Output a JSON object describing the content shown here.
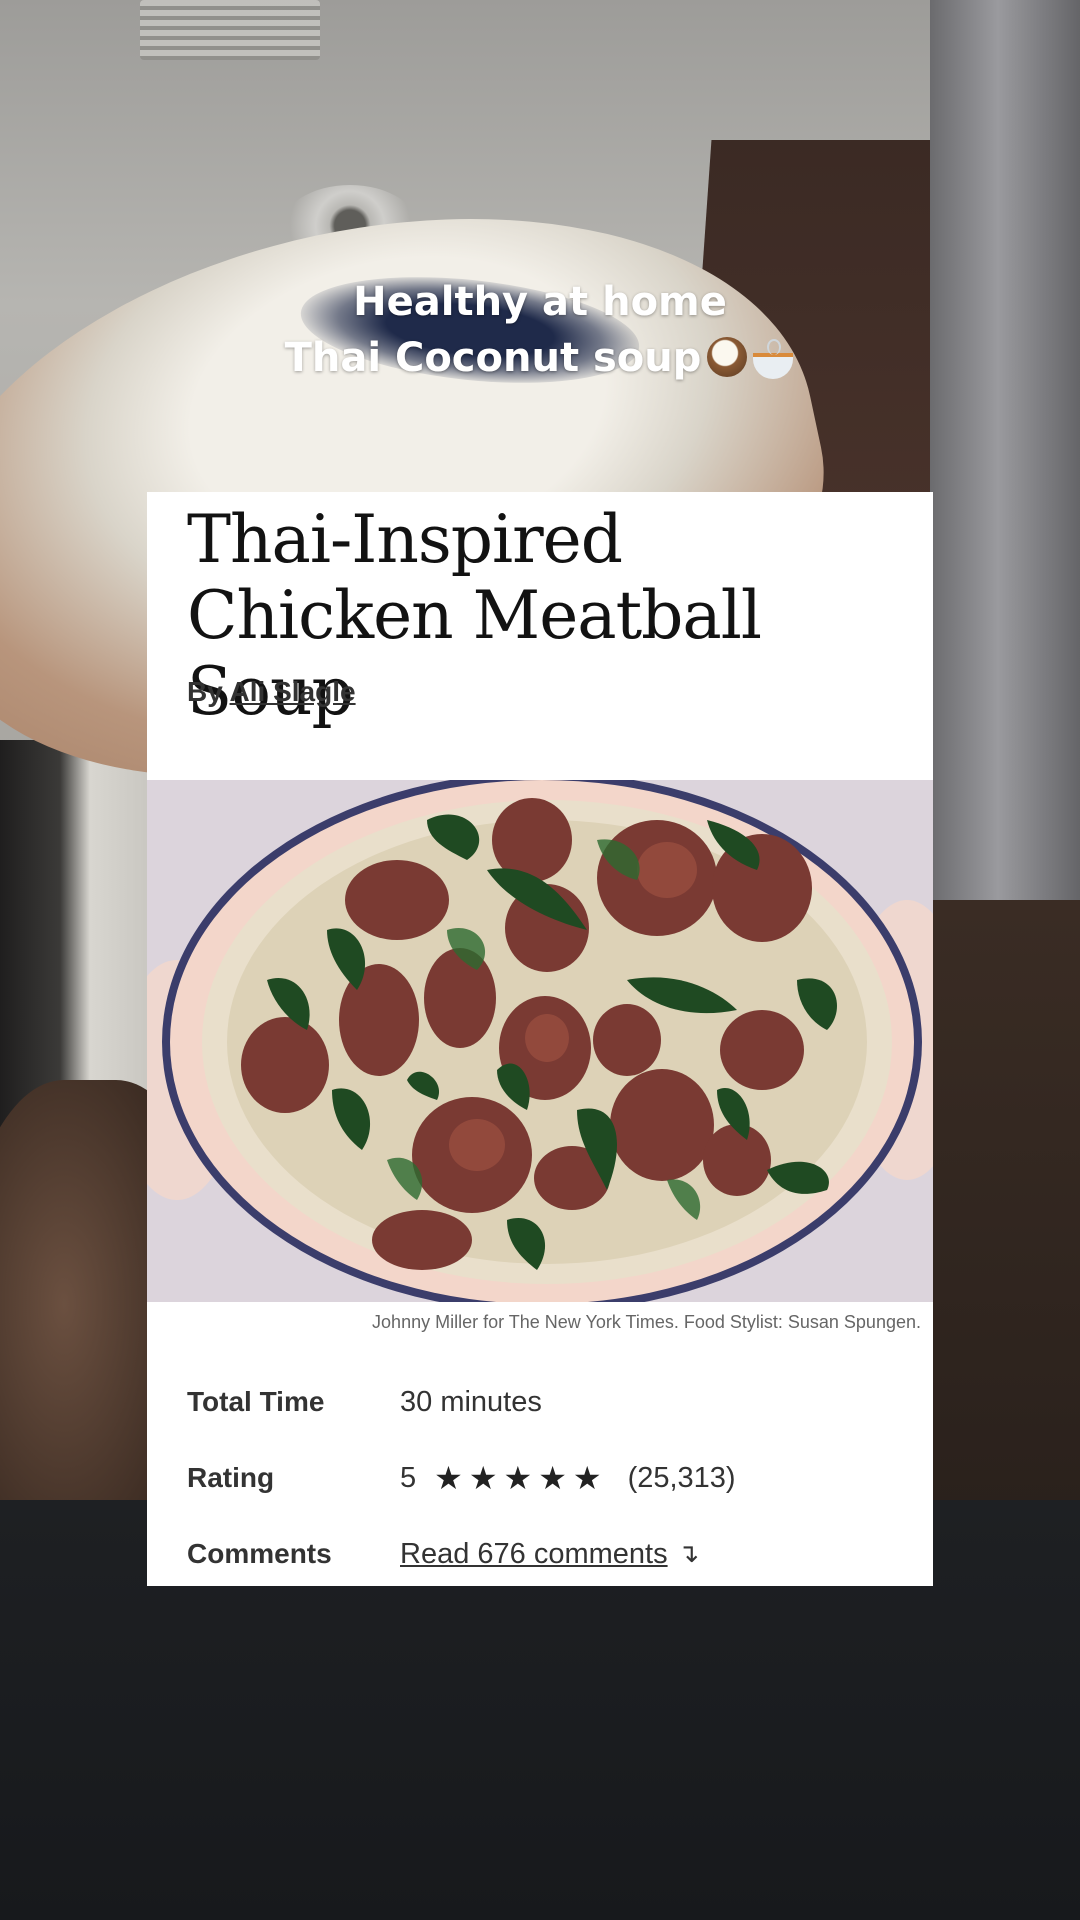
{
  "caption": {
    "line1": "Healthy at home",
    "line2": "Thai Coconut soup"
  },
  "recipe": {
    "title": "Thai-Inspired Chicken Meatball Soup",
    "byline_prefix": "By",
    "author": "Ali Slagle",
    "photo_credit": "Johnny Miller for The New York Times. Food Stylist: Susan Spungen.",
    "details": {
      "total_time_label": "Total Time",
      "total_time_value": "30 minutes",
      "rating_label": "Rating",
      "rating_value": "5",
      "rating_stars": "★★★★★",
      "rating_count": "(25,313)",
      "comments_label": "Comments",
      "comments_link": "Read 676 comments",
      "comments_arrow": "↴"
    }
  },
  "icons": {
    "coconut": "coconut-emoji-icon",
    "bowl": "soup-bowl-emoji-icon",
    "stars": "star-icon",
    "arrow": "arrow-down-icon"
  },
  "colors": {
    "card_bg": "#ffffff",
    "text": "#333333",
    "title": "#121212",
    "caption": "#ffffff"
  }
}
